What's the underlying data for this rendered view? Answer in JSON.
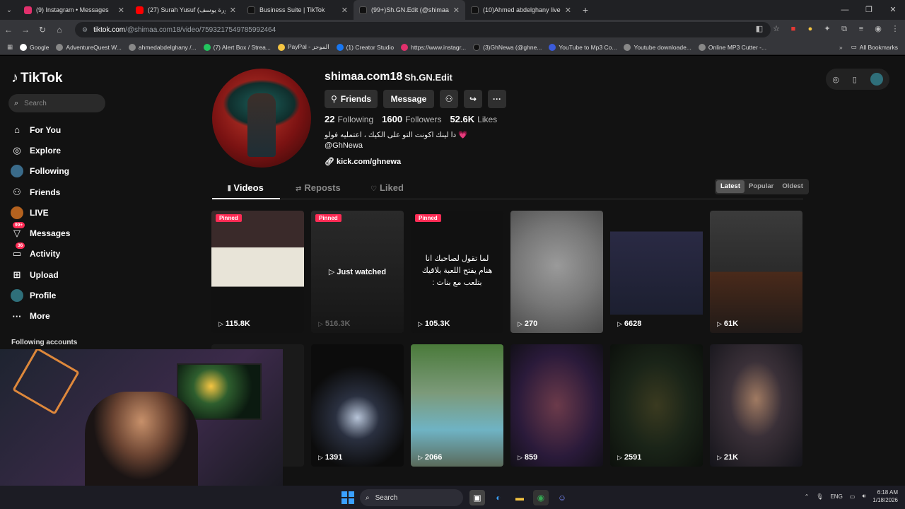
{
  "browser": {
    "tabs": [
      {
        "title": "(9) Instagram • Messages",
        "color": "#e1306c"
      },
      {
        "title": "(27) Surah Yusuf (سورة يوسف)",
        "color": "#ff0000"
      },
      {
        "title": "Business Suite | TikTok",
        "color": "#000000"
      },
      {
        "title": "(99+)Sh.GN.Edit (@shimaa...",
        "color": "#000000",
        "active": true
      },
      {
        "title": "(10)Ahmed abdelghany live (@...",
        "color": "#000000"
      }
    ],
    "url_host": "tiktok.com",
    "url_path": "/@shimaa.com18/video/7593217549785992464",
    "bookmarks": [
      "Google",
      "AdventureQuest W...",
      "ahmedabdelghany /...",
      "(7) Alert Box / Strea...",
      "PayPal - الموجز",
      "(1) Creator Studio",
      "https://www.instagr...",
      "(3)GhNewa (@ghne...",
      "YouTube to Mp3 Co...",
      "Youtube downloade...",
      "Online MP3 Cutter -..."
    ],
    "all_bookmarks": "All Bookmarks"
  },
  "sidebar": {
    "logo": "TikTok",
    "search_placeholder": "Search",
    "items": [
      {
        "label": "For You",
        "icon": "home-icon"
      },
      {
        "label": "Explore",
        "icon": "compass-icon"
      },
      {
        "label": "Following",
        "icon": "following-icon"
      },
      {
        "label": "Friends",
        "icon": "friends-icon"
      },
      {
        "label": "LIVE",
        "icon": "live-icon"
      },
      {
        "label": "Messages",
        "icon": "messages-icon",
        "badge": "99+"
      },
      {
        "label": "Activity",
        "icon": "activity-icon",
        "badge": "36"
      },
      {
        "label": "Upload",
        "icon": "upload-icon"
      },
      {
        "label": "Profile",
        "icon": "profile-icon"
      },
      {
        "label": "More",
        "icon": "more-icon"
      }
    ],
    "following_accounts": "Following accounts"
  },
  "profile": {
    "username": "shimaa.com18",
    "nickname": "Sh.GN.Edit",
    "buttons": {
      "friends": "Friends",
      "message": "Message"
    },
    "stats": {
      "following": "22",
      "following_label": "Following",
      "followers": "1600",
      "followers_label": "Followers",
      "likes": "52.6K",
      "likes_label": "Likes"
    },
    "bio_line1": "دا لينك اكونت التو على الكيك ، اعتمليه فولو 💗",
    "bio_line2": "@GhNewa",
    "link": "kick.com/ghnewa",
    "tabs": [
      "Videos",
      "Reposts",
      "Liked"
    ],
    "sort": [
      "Latest",
      "Popular",
      "Oldest"
    ]
  },
  "videos": [
    {
      "views": "115.8K",
      "pinned": "Pinned"
    },
    {
      "views": "516.3K",
      "pinned": "Pinned",
      "overlay": "Just watched"
    },
    {
      "views": "105.3K",
      "pinned": "Pinned",
      "text": "لما تقول لصاحبك انا هنام يفتح اللعبة بلاقيك بتلعب مع بنات :"
    },
    {
      "views": "270"
    },
    {
      "views": "6628"
    },
    {
      "views": "61K"
    },
    {
      "views": ""
    },
    {
      "views": "1391"
    },
    {
      "views": "2066"
    },
    {
      "views": "859"
    },
    {
      "views": "2591"
    },
    {
      "views": "21K"
    }
  ],
  "taskbar": {
    "search": "Search",
    "lang": "ENG",
    "time": "6:18 AM",
    "date": "1/18/2026"
  }
}
